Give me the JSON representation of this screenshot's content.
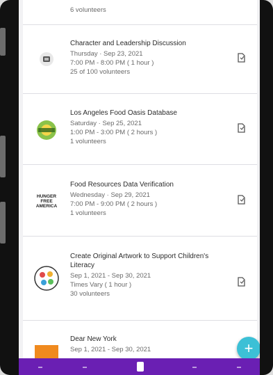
{
  "events": [
    {
      "title": "",
      "lines": [
        "6 volunteers"
      ]
    },
    {
      "title": "Character and Leadership Discussion",
      "lines": [
        "Thursday · Sep 23, 2021",
        "7:00 PM - 8:00 PM ( 1 hour )",
        "25 of 100 volunteers"
      ],
      "thumb": "gear-logo"
    },
    {
      "title": "Los Angeles Food Oasis Database",
      "lines": [
        "Saturday · Sep 25, 2021",
        "1:00 PM - 3:00 PM ( 2 hours )",
        "1 volunteers"
      ],
      "thumb": "sun-logo"
    },
    {
      "title": "Food Resources Data Verification",
      "lines": [
        "Wednesday · Sep 29, 2021",
        "7:00 PM - 9:00 PM ( 2 hours )",
        "1 volunteers"
      ],
      "thumb": "hunger-logo",
      "thumb_text": "HUNGER FREE AMERICA"
    },
    {
      "title": "Create Original Artwork to Support Children's Literacy",
      "lines": [
        "Sep 1, 2021 - Sep 30, 2021",
        "Times Vary ( 1 hour )",
        "30 volunteers"
      ],
      "thumb": "artwork-logo"
    },
    {
      "title": "Dear New York",
      "lines": [
        "Sep 1, 2021 - Sep 30, 2021"
      ],
      "thumb": "orange-logo"
    }
  ],
  "fab_label": "+",
  "icons": {
    "signup": "calendar-add-icon",
    "fab": "plus-icon"
  },
  "colors": {
    "nav": "#6a1fb3",
    "fab": "#3cc0d6",
    "accent_green": "#8bc34a"
  }
}
